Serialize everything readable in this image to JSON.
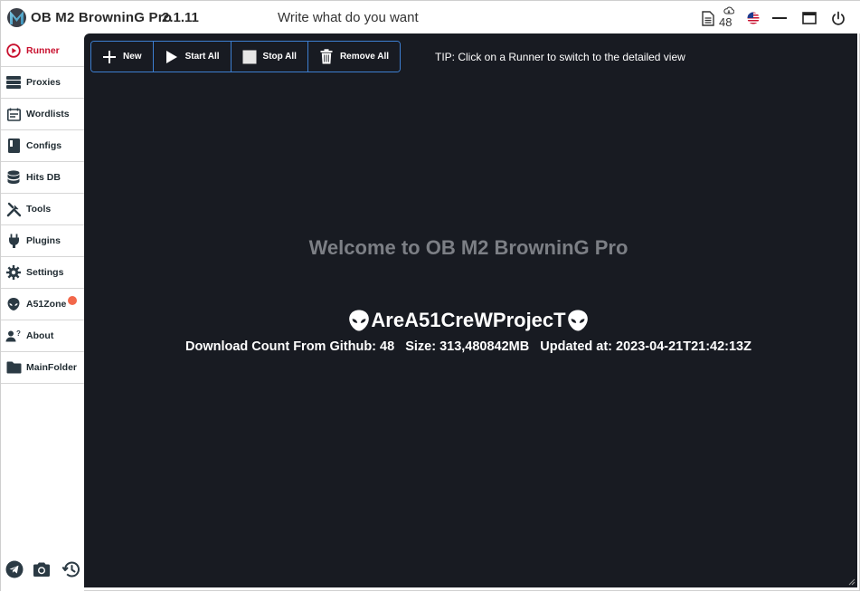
{
  "app": {
    "title": "OB M2 BrowninG Pro",
    "version": "2.1.11",
    "search_placeholder": "Write what do you want",
    "cloud_count": "48"
  },
  "sidebar": {
    "items": [
      {
        "label": "Runner",
        "icon": "play-circle-icon",
        "active": true
      },
      {
        "label": "Proxies",
        "icon": "server-icon"
      },
      {
        "label": "Wordlists",
        "icon": "calendar-list-icon"
      },
      {
        "label": "Configs",
        "icon": "book-icon"
      },
      {
        "label": "Hits DB",
        "icon": "database-icon"
      },
      {
        "label": "Tools",
        "icon": "tools-icon"
      },
      {
        "label": "Plugins",
        "icon": "plug-icon"
      },
      {
        "label": "Settings",
        "icon": "gear-icon"
      },
      {
        "label": "A51Zone",
        "icon": "alien-icon",
        "notification": true
      },
      {
        "label": "About",
        "icon": "user-question-icon"
      },
      {
        "label": "MainFolder",
        "icon": "folder-icon"
      }
    ],
    "bottom_icons": [
      "telegram-icon",
      "camera-icon",
      "history-icon"
    ]
  },
  "toolbar": {
    "new_label": "New",
    "start_all_label": "Start All",
    "stop_all_label": "Stop All",
    "remove_all_label": "Remove All"
  },
  "tip": "TIP: Click on a Runner to switch to the detailed view",
  "main": {
    "welcome": "Welcome to OB M2 BrowninG Pro",
    "crew": "AreA51CreWProjecT",
    "download_count": "Download Count From Github: 48",
    "size": "Size: 313,480842MB",
    "updated": "Updated at: 2023-04-21T21:42:13Z"
  },
  "colors": {
    "accent_red": "#c8102e",
    "main_bg": "#181b22",
    "toolbar_border": "#3d7fd1",
    "notify": "#f2674a"
  }
}
